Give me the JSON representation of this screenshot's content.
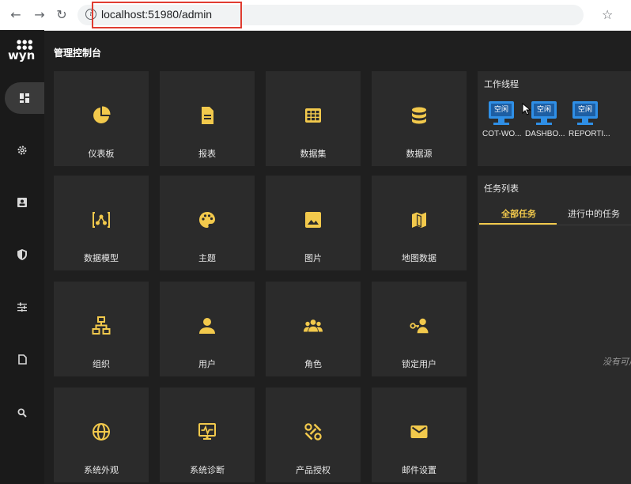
{
  "browser": {
    "url": "localhost:51980/admin",
    "back_icon": "arrow-left",
    "forward_icon": "arrow-right",
    "reload_icon": "reload",
    "info_icon": "info",
    "star_icon": "star"
  },
  "app": {
    "logo_text": "wyn",
    "title": "管理控制台"
  },
  "sidebar": {
    "items": [
      {
        "name": "dashboard-grid-icon",
        "active": true
      },
      {
        "name": "gear-icon",
        "active": false
      },
      {
        "name": "contact-card-icon",
        "active": false
      },
      {
        "name": "shield-icon",
        "active": false
      },
      {
        "name": "sliders-icon",
        "active": false
      },
      {
        "name": "document-icon",
        "active": false
      },
      {
        "name": "search-icon",
        "active": false
      }
    ]
  },
  "tiles": [
    {
      "label": "仪表板",
      "icon": "pie-chart-icon"
    },
    {
      "label": "报表",
      "icon": "document-icon"
    },
    {
      "label": "数据集",
      "icon": "table-icon"
    },
    {
      "label": "数据源",
      "icon": "database-icon"
    },
    {
      "label": "数据模型",
      "icon": "data-model-icon"
    },
    {
      "label": "主题",
      "icon": "palette-icon"
    },
    {
      "label": "图片",
      "icon": "image-icon"
    },
    {
      "label": "地图数据",
      "icon": "map-icon"
    },
    {
      "label": "组织",
      "icon": "org-chart-icon"
    },
    {
      "label": "用户",
      "icon": "user-icon"
    },
    {
      "label": "角色",
      "icon": "group-icon"
    },
    {
      "label": "锁定用户",
      "icon": "locked-user-icon"
    },
    {
      "label": "系统外观",
      "icon": "globe-icon"
    },
    {
      "label": "系统诊断",
      "icon": "monitor-pulse-icon"
    },
    {
      "label": "产品授权",
      "icon": "license-icon"
    },
    {
      "label": "邮件设置",
      "icon": "mail-icon"
    }
  ],
  "workers_panel": {
    "title": "工作线程",
    "workers": [
      {
        "status": "空闲",
        "name": "COT-WO..."
      },
      {
        "status": "空闲",
        "name": "DASHBO..."
      },
      {
        "status": "空闲",
        "name": "REPORTI..."
      }
    ]
  },
  "tasks_panel": {
    "title": "任务列表",
    "tabs": [
      {
        "label": "全部任务",
        "active": true
      },
      {
        "label": "进行中的任务",
        "active": false
      }
    ],
    "empty_text": "没有可用"
  },
  "colors": {
    "accent": "#f2c94c",
    "background": "#1f1f1f",
    "tile": "#2b2b2b",
    "worker_blue": "#2f8fe6",
    "highlight": "#e03c31"
  }
}
